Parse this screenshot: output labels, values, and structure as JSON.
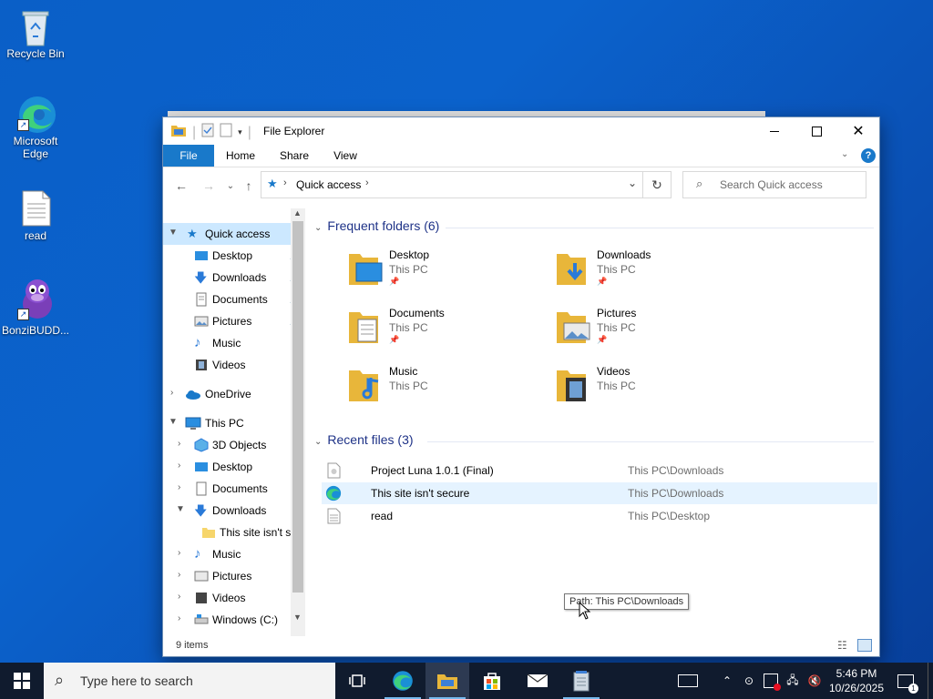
{
  "desktop": {
    "icons": [
      {
        "label": "Recycle Bin"
      },
      {
        "label": "Microsoft Edge"
      },
      {
        "label": "read"
      },
      {
        "label": "BonziBUDD..."
      }
    ]
  },
  "window": {
    "title": "File Explorer",
    "ribbon_tabs": [
      "File",
      "Home",
      "Share",
      "View"
    ],
    "address": {
      "root_label": "Quick access"
    },
    "search_placeholder": "Search Quick access"
  },
  "nav": {
    "quick_access": "Quick access",
    "quick_items": [
      "Desktop",
      "Downloads",
      "Documents",
      "Pictures",
      "Music",
      "Videos"
    ],
    "onedrive": "OneDrive",
    "this_pc": "This PC",
    "pc_items": [
      "3D Objects",
      "Desktop",
      "Documents",
      "Downloads"
    ],
    "downloads_child": "This site isn't se",
    "pc_items_after": [
      "Music",
      "Pictures",
      "Videos",
      "Windows (C:)"
    ]
  },
  "frequent": {
    "header": "Frequent folders (6)",
    "items": [
      {
        "name": "Desktop",
        "location": "This PC",
        "pinned": true
      },
      {
        "name": "Downloads",
        "location": "This PC",
        "pinned": true
      },
      {
        "name": "Documents",
        "location": "This PC",
        "pinned": true
      },
      {
        "name": "Pictures",
        "location": "This PC",
        "pinned": true
      },
      {
        "name": "Music",
        "location": "This PC",
        "pinned": false
      },
      {
        "name": "Videos",
        "location": "This PC",
        "pinned": false
      }
    ]
  },
  "recent": {
    "header": "Recent files (3)",
    "items": [
      {
        "name": "Project Luna 1.0.1 (Final)",
        "path": "This PC\\Downloads"
      },
      {
        "name": "This site isn't secure",
        "path": "This PC\\Downloads"
      },
      {
        "name": "read",
        "path": "This PC\\Desktop"
      }
    ],
    "tooltip": "Path: This PC\\Downloads"
  },
  "status": {
    "items": "9 items"
  },
  "taskbar": {
    "search_placeholder": "Type here to search",
    "time": "5:46 PM",
    "date": "10/26/2025"
  },
  "colors": {
    "accent": "#1979ca",
    "selection": "#cce8ff",
    "header_blue": "#1e3287"
  }
}
